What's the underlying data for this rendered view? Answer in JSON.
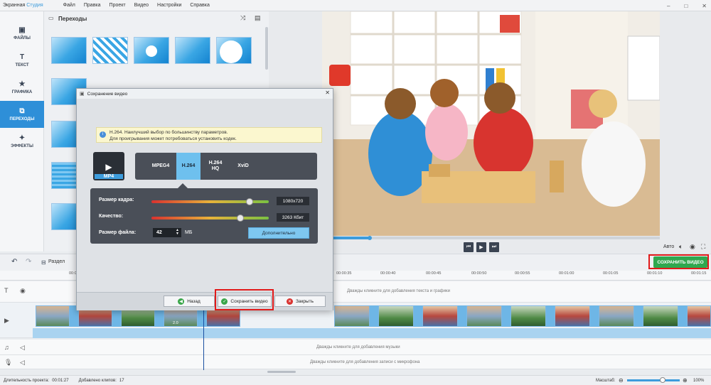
{
  "app": {
    "title_main": "Экранная ",
    "title_accent": "Студия",
    "menu": [
      "Файл",
      "Правка",
      "Проект",
      "Видео",
      "Настройки",
      "Справка"
    ],
    "window_controls": [
      "–",
      "□",
      "✕"
    ],
    "accent_color": "#3d9cdc"
  },
  "sidebar": {
    "items": [
      {
        "label": "ФАЙЛЫ",
        "icon": "image-icon"
      },
      {
        "label": "ТЕКСТ",
        "icon": "text-icon"
      },
      {
        "label": "ГРАФИКА",
        "icon": "star-icon"
      },
      {
        "label": "ПЕРЕХОДЫ",
        "icon": "transitions-icon",
        "active": true
      },
      {
        "label": "ЭФФЕКТЫ",
        "icon": "magic-wand-icon"
      }
    ]
  },
  "transitions": {
    "title": "Переходы"
  },
  "preview": {
    "auto_label": "Авто",
    "progress": 0.14
  },
  "toolbar": {
    "split_label": "Раздел",
    "save_video_label": "СОХРАНИТЬ ВИДЕО",
    "save_color": "#2fa84f"
  },
  "timeline": {
    "ticks": [
      "00:0",
      "00:00:35",
      "00:00:40",
      "00:00:45",
      "00:00:50",
      "00:00:55",
      "00:01:00",
      "00:01:05",
      "00:01:10",
      "00:01:15"
    ],
    "text_hint": "Дважды кликните для добавления текста и графики",
    "music_hint": "Дважды кликните для добавления музыки",
    "mic_hint": "Дважды кликните для добавления записи с микрофона",
    "clip_duration": "2.0"
  },
  "status": {
    "duration_label": "Длительность проекта:",
    "duration_value": "00:01:27",
    "clips_label": "Добавлено клипов:",
    "clips_value": "17",
    "zoom_label": "Масштаб:",
    "zoom_value": "100%"
  },
  "dialog": {
    "title": "Сохранение видео",
    "info_line1": "H.264. Наилучший выбор по большинству параметров.",
    "info_line2": "Для проигрывания может потребоваться установить кодек.",
    "container_label": "MP4",
    "formats": [
      "MPEG4",
      "H.264",
      "H.264\nHQ",
      "XviD"
    ],
    "frame_size_label": "Размер кадра:",
    "frame_size_value": "1080x720",
    "quality_label": "Качество:",
    "quality_value": "3263 Кбит",
    "file_size_label": "Размер файла:",
    "file_size_value": "42",
    "file_size_unit": "МБ",
    "advanced_label": "Дополнительно",
    "back_label": "Назад",
    "save_label": "Сохранить видео",
    "close_label": "Закрыть"
  }
}
